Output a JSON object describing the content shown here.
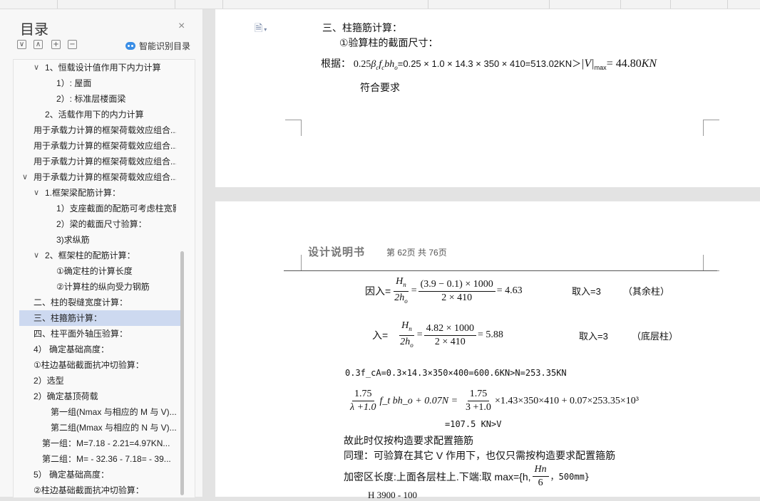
{
  "sidebar": {
    "title": "目录",
    "close": "×",
    "buttons": [
      "∨",
      "∧",
      "+",
      "−"
    ],
    "smart": "智能识别目录",
    "items": [
      {
        "label": "1、恒载设计值作用下内力计算",
        "chev": "∨"
      },
      {
        "label": "1）: 屋面",
        "chev": ""
      },
      {
        "label": "2）: 标准层楼面梁",
        "chev": ""
      },
      {
        "label": "2、活载作用下的内力计算",
        "chev": ""
      },
      {
        "label": "用于承载力计算的框架荷载效应组合...",
        "chev": ""
      },
      {
        "label": "用于承载力计算的框架荷载效应组合...",
        "chev": ""
      },
      {
        "label": "用于承载力计算的框架荷载效应组合...",
        "chev": ""
      },
      {
        "label": "用于承载力计算的框架荷载效应组合...",
        "chev": "∨"
      },
      {
        "label": "1.框架梁配筋计算：",
        "chev": "∨"
      },
      {
        "label": "1）支座截面的配筋可考虑柱宽影响...",
        "chev": ""
      },
      {
        "label": "2）梁的截面尺寸验算：",
        "chev": ""
      },
      {
        "label": "3)求纵筋",
        "chev": ""
      },
      {
        "label": "2、框架柱的配筋计算：",
        "chev": "∨"
      },
      {
        "label": "①确定柱的计算长度",
        "chev": ""
      },
      {
        "label": "②计算柱的纵向受力钢筋",
        "chev": ""
      },
      {
        "label": "二、柱的裂缝宽度计算：",
        "chev": ""
      },
      {
        "label": "三、柱箍筋计算：",
        "chev": ""
      },
      {
        "label": "四、柱平面外轴压验算：",
        "chev": ""
      },
      {
        "label": "4） 确定基础高度：",
        "chev": ""
      },
      {
        "label": "①柱边基础截面抗冲切验算：",
        "chev": ""
      },
      {
        "label": "2）选型",
        "chev": ""
      },
      {
        "label": "2）确定基顶荷载",
        "chev": ""
      },
      {
        "label": "第一组(Nmax 与相应的 M 与 V)...",
        "chev": ""
      },
      {
        "label": "第二组(Mmax 与相应的 N 与 V)...",
        "chev": ""
      },
      {
        "label": "第一组：M=7.18 - 2.21=4.97KN...",
        "chev": ""
      },
      {
        "label": "第二组：M= - 32.36 - 7.18= - 39...",
        "chev": ""
      },
      {
        "label": "5） 确定基础高度：",
        "chev": ""
      },
      {
        "label": "②柱边基础截面抗冲切验算：",
        "chev": ""
      }
    ]
  },
  "page1": {
    "doc_icon": "🗎",
    "doc_dd": "▾",
    "heading": "三、柱箍筋计算：",
    "sub": "①验算柱的截面尺寸：",
    "basis_label": "根据：",
    "formula_pre": "0.25",
    "beta_sym": "β",
    "beta_sub": "c",
    "f_sym": "f",
    "f_sub": "c",
    "bh_sym": "bh",
    "bh_sub": "o",
    "formula_main": "=0.25 × 1.0 × 14.3 × 350 × 410=513.02KN＞",
    "v_sym": "|V|",
    "v_sub": "max",
    "v_eq": "= 44.80",
    "v_unit": "KN",
    "result": "符合要求"
  },
  "page2": {
    "header_title": "设计说明书",
    "header_page": "第 62页 共 76页",
    "lambda1_label": "因入=",
    "lambda1_frac1": {
      "n": "H",
      "nsub": "n",
      "d": "2h",
      "dsub": "o"
    },
    "lambda1_frac2": {
      "n": "(3.9 − 0.1) × 1000",
      "d": "2 × 410"
    },
    "lambda1_res": "= 4.63",
    "lambda1_take": "取入=3",
    "lambda1_note": "（其余柱）",
    "lambda2_label": "入=",
    "lambda2_frac2": {
      "n": "4.82 × 1000",
      "d": "2 × 410"
    },
    "lambda2_res": "= 5.88",
    "lambda2_take": "取入=3",
    "lambda2_note": "（底层柱）",
    "line1": "0.3f_cA=0.3×14.3×350×400=600.6KN>N=253.35KN",
    "eq_frac1": {
      "n": "1.75",
      "d": "λ +1.0"
    },
    "eq_mid": "f_t bh_o + 0.07N =",
    "eq_frac2": {
      "n": "1.75",
      "d": "3 +1.0"
    },
    "eq_tail": "×1.43×350×410 + 0.07×253.35×10³",
    "eq_result": "=107.5  KN>V",
    "text1": "故此时仅按构造要求配置箍筋",
    "text2": "同理：可验算在其它 V 作用下，也仅只需按构造要求配置箍筋",
    "text3_pre": "加密区长度:上面各层柱上.下端:取 max={h,",
    "text3_frac": {
      "n": "Hn",
      "d": "6"
    },
    "text3_post": "，500mm}",
    "bottom_partial": "H    3900 - 100"
  }
}
